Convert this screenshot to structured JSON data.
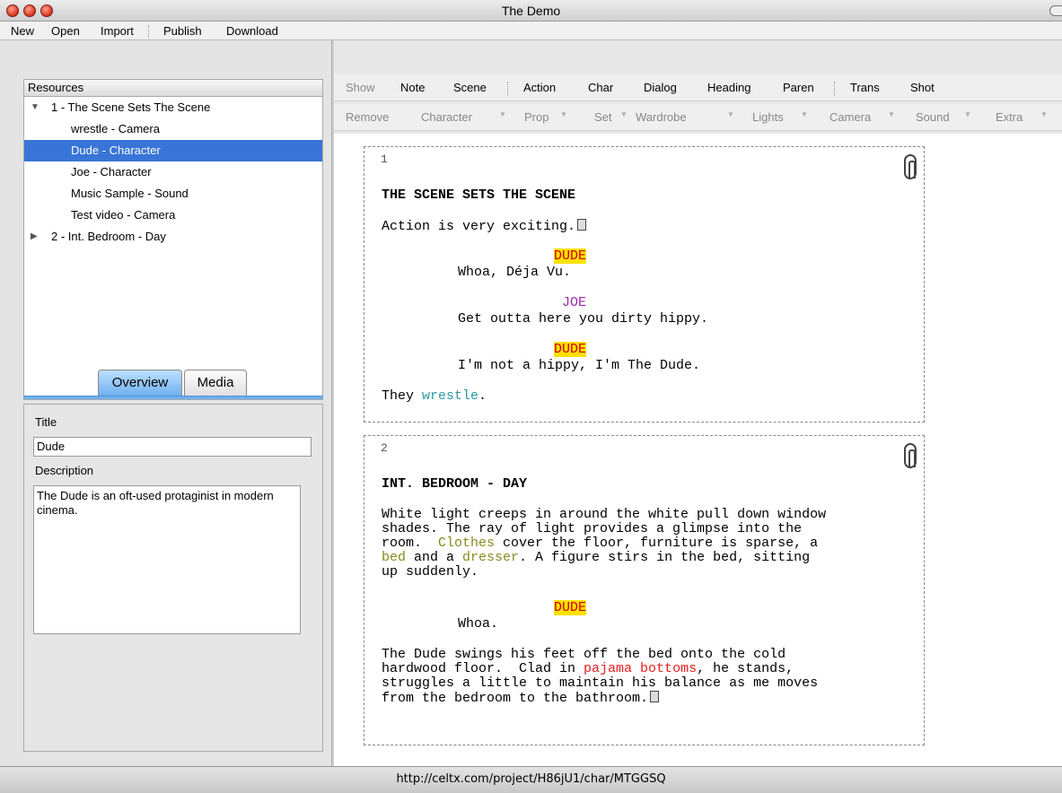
{
  "window": {
    "title": "The Demo"
  },
  "menu": {
    "new": "New",
    "open": "Open",
    "import": "Import",
    "publish": "Publish",
    "download": "Download"
  },
  "resources": {
    "header": "Resources",
    "items": [
      {
        "label": "1 - The Scene Sets The Scene",
        "expanded": true
      },
      {
        "label": "wrestle - Camera"
      },
      {
        "label": "Dude - Character",
        "selected": true
      },
      {
        "label": "Joe - Character"
      },
      {
        "label": "Music Sample - Sound"
      },
      {
        "label": "Test video - Camera"
      },
      {
        "label": "2 - Int. Bedroom - Day",
        "expanded": false
      }
    ]
  },
  "tabs": {
    "overview": "Overview",
    "media": "Media"
  },
  "properties": {
    "title_label": "Title",
    "title_value": "Dude",
    "description_label": "Description",
    "description_value": "The Dude is an oft-used protaginist in modern cinema."
  },
  "toolbar1": {
    "show": "Show",
    "note": "Note",
    "scene": "Scene",
    "action": "Action",
    "char": "Char",
    "dialog": "Dialog",
    "heading": "Heading",
    "paren": "Paren",
    "trans": "Trans",
    "shot": "Shot"
  },
  "toolbar2": {
    "remove": "Remove",
    "character": "Character",
    "prop": "Prop",
    "set": "Set",
    "wardrobe": "Wardrobe",
    "lights": "Lights",
    "camera": "Camera",
    "sound": "Sound",
    "extra": "Extra"
  },
  "script": {
    "page1": {
      "number": "1",
      "heading": "THE SCENE SETS THE SCENE",
      "action": "Action is very exciting.",
      "char1": "DUDE",
      "dialog1": "Whoa, Déja Vu.",
      "char2": "JOE",
      "dialog2": "Get outta here you dirty hippy.",
      "char3": "DUDE",
      "dialog3": "I'm not a hippy, I'm The Dude.",
      "they_pre": "They ",
      "they_word": "wrestle",
      "they_post": "."
    },
    "page2": {
      "number": "2",
      "heading": "INT. BEDROOM - DAY",
      "a_l1": "White light creeps in around the white pull down window",
      "a_l2": "shades. The ray of light provides a glimpse into the",
      "a_l3_pre": "room.  ",
      "a_l3_clothes": "Clothes",
      "a_l3_post": " cover the floor, furniture is sparse, a",
      "a_l4_bed": "bed",
      "a_l4_mid": " and a ",
      "a_l4_dresser": "dresser",
      "a_l4_post": ". A figure stirs in the bed, sitting",
      "a_l5": "up suddenly.",
      "char1": "DUDE",
      "dialog1": "Whoa.",
      "b_l1": "The Dude swings his feet off the bed onto the cold",
      "b_l2_pre": "hardwood floor.  Clad in ",
      "b_l2_pj": "pajama bottoms",
      "b_l2_post": ", he stands,",
      "b_l3": "struggles a little to maintain his balance as me moves",
      "b_l4": "from the bedroom to the bathroom."
    }
  },
  "status": {
    "url": "http://celtx.com/project/H86jU1/char/MTGGSQ"
  }
}
